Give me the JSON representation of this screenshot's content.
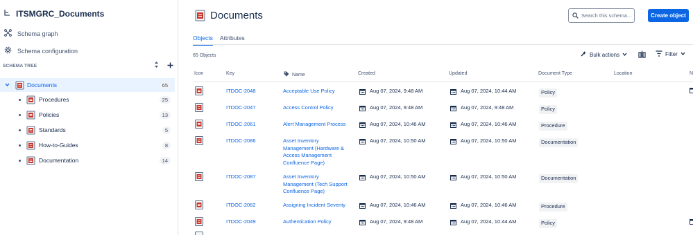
{
  "sidebar": {
    "title": "ITSMGRC_Documents",
    "links": [
      "Schema graph",
      "Schema configuration"
    ],
    "tree_label": "SCHEMA TREE",
    "root": {
      "label": "Documents",
      "count": "65"
    },
    "children": [
      {
        "label": "Procedures",
        "count": "25"
      },
      {
        "label": "Policies",
        "count": "13"
      },
      {
        "label": "Standards",
        "count": "5"
      },
      {
        "label": "How-to-Guides",
        "count": "8"
      },
      {
        "label": "Documentation",
        "count": "14"
      }
    ]
  },
  "main": {
    "title": "Documents",
    "search_placeholder": "Search this schema...",
    "create_label": "Create object",
    "tabs": [
      "Objects",
      "Attributes"
    ],
    "object_count": "65 Objects",
    "bulk_actions": "Bulk actions",
    "filter": "Filter",
    "columns": {
      "icon": "Icon",
      "key": "Key",
      "name": "Name",
      "created": "Created",
      "updated": "Updated",
      "type": "Document Type",
      "location": "Location",
      "next": "N"
    },
    "rows": [
      {
        "key": "ITDOC-2048",
        "name": "Acceptable Use Policy",
        "created": "Aug 07, 2024, 9:48 AM",
        "updated": "Aug 07, 2024, 10:44 AM",
        "type": "Policy"
      },
      {
        "key": "ITDOC-2047",
        "name": "Access Control Policy",
        "created": "Aug 07, 2024, 9:48 AM",
        "updated": "Aug 07, 2024, 9:48 AM",
        "type": "Policy"
      },
      {
        "key": "ITDOC-2061",
        "name": "Alert Management Process",
        "created": "Aug 07, 2024, 10:46 AM",
        "updated": "Aug 07, 2024, 10:46 AM",
        "type": "Procedure"
      },
      {
        "key": "ITDOC-2086",
        "name_lines": [
          "Asset Inventory",
          "Management (Hardware &",
          "Access Management",
          "Confluence Page)"
        ],
        "created": "Aug 07, 2024, 10:50 AM",
        "updated": "Aug 07, 2024, 10:50 AM",
        "type": "Documentation"
      },
      {
        "key": "ITDOC-2087",
        "name_lines": [
          "Asset Inventory",
          "Management (Tech Support",
          "Confluence Page)"
        ],
        "created": "Aug 07, 2024, 10:50 AM",
        "updated": "Aug 07, 2024, 10:50 AM",
        "type": "Documentation"
      },
      {
        "key": "ITDOC-2062",
        "name": "Assigning Incident Severity",
        "created": "Aug 07, 2024, 10:46 AM",
        "updated": "Aug 07, 2024, 10:46 AM",
        "type": "Procedure"
      },
      {
        "key": "ITDOC-2049",
        "name": "Authentication Policy",
        "created": "Aug 07, 2024, 9:48 AM",
        "updated": "Aug 07, 2024, 10:44 AM",
        "type": "Policy"
      }
    ]
  },
  "colors": {
    "accent": "#0c66e4",
    "selected_bg": "#e9f2ff",
    "doc_icon": "#c9372c"
  }
}
